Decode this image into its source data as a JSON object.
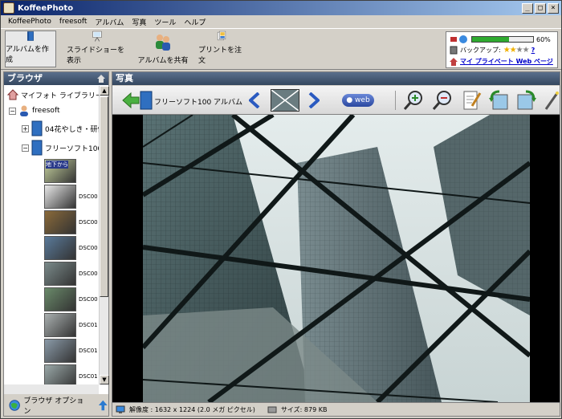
{
  "window": {
    "title": "KoffeePhoto"
  },
  "menu": [
    "KoffeePhoto",
    "freesoft",
    "アルバム",
    "写真",
    "ツール",
    "ヘルプ"
  ],
  "toolbar": {
    "create_album": "アルバムを作成",
    "slideshow": "スライドショーを表示",
    "share_album": "アルバムを共有",
    "order_prints": "プリントを注文"
  },
  "status": {
    "progress_percent": 60,
    "progress_label": "60%",
    "backup_label": "バックアップ:",
    "backup_rating": 2,
    "backup_rating_max": 4,
    "backup_help": "?",
    "private_web_link": "マイ プライベート Web ページ"
  },
  "browser": {
    "title": "ブラウザ",
    "library": "マイフォト ライブラリー",
    "user": "freesoft",
    "album1": "04花やしき・研修",
    "album2": "フリーソフト100 ア",
    "thumbs": [
      {
        "label": "地下から"
      },
      {
        "label": "DSC00"
      },
      {
        "label": "DSC00"
      },
      {
        "label": "DSC00"
      },
      {
        "label": "DSC00"
      },
      {
        "label": "DSC00"
      },
      {
        "label": "DSC01"
      },
      {
        "label": "DSC01"
      },
      {
        "label": "DSC01"
      },
      {
        "label": "DSC01"
      }
    ],
    "options": "ブラウザ オプション"
  },
  "photo": {
    "title": "写真",
    "album_name": "フリーソフト100 アルバム",
    "web_button": "web",
    "resolution": "解像度 : 1632 x 1224 (2.0 メガ ピクセル)",
    "size": "サイズ: 879 KB"
  }
}
